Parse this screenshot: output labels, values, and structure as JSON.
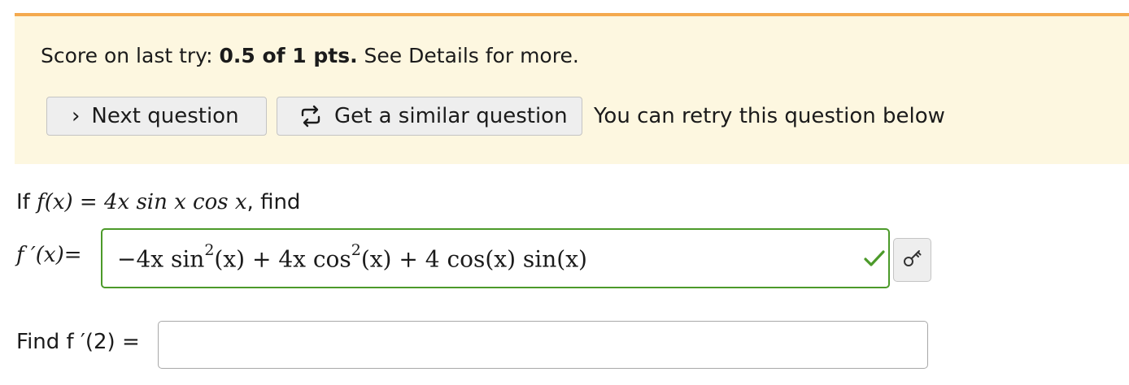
{
  "score": {
    "prefix": "Score on last try: ",
    "value": "0.5 of 1 pts.",
    "suffix": " See Details for more."
  },
  "buttons": {
    "next_icon": "›",
    "next_label": "Next question",
    "similar_icon": "refresh-arrows-icon",
    "similar_label": "Get a similar question"
  },
  "retry_note": "You can retry this question below",
  "question": {
    "if_text": "If ",
    "function_def": "f(x) = 4x sin x cos x",
    "find_text": ", find",
    "derivative_label": "f ′(x)=",
    "answer": {
      "t1": "−4x sin",
      "exp1": "2",
      "t2": "(x) + 4x cos",
      "exp2": "2",
      "t3": "(x) + 4 cos(x) sin(x)"
    },
    "answer_status": "correct",
    "find_label": "Find f ′(2) =",
    "find_value": ""
  },
  "colors": {
    "accent_bar": "#f4a94e",
    "panel_bg": "#fdf7e0",
    "correct_green": "#4c9a2a"
  }
}
